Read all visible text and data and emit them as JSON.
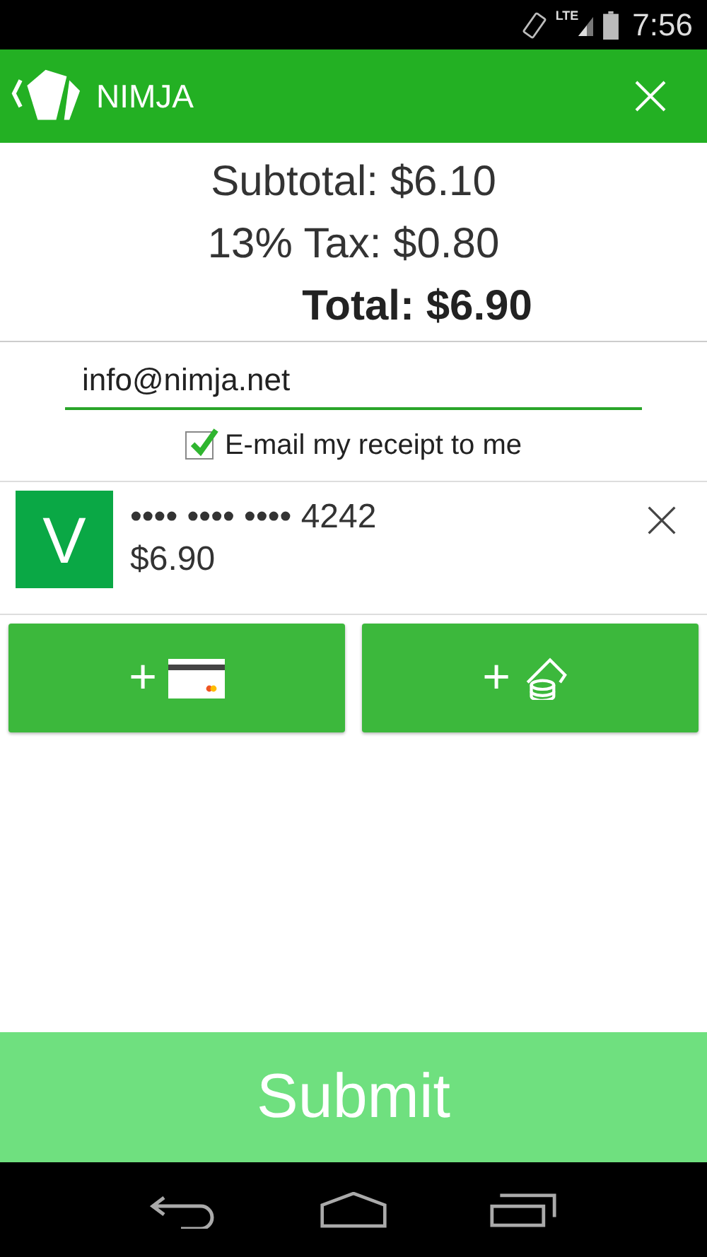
{
  "status_bar": {
    "time": "7:56",
    "network": "LTE"
  },
  "app_bar": {
    "title": "NIMJA"
  },
  "totals": {
    "subtotal": "Subtotal: $6.10",
    "tax": "13% Tax: $0.80",
    "total": "Total: $6.90"
  },
  "email": {
    "value": "info@nimja.net"
  },
  "receipt_option": {
    "label": "E-mail my receipt to me",
    "checked": true
  },
  "payments": [
    {
      "badge": "V",
      "number": "•••• •••• •••• 4242",
      "amount": "$6.90"
    }
  ],
  "add_buttons": [
    {
      "kind": "card",
      "plus": "+"
    },
    {
      "kind": "cash",
      "plus": "+"
    }
  ],
  "submit": {
    "label": "Submit"
  }
}
